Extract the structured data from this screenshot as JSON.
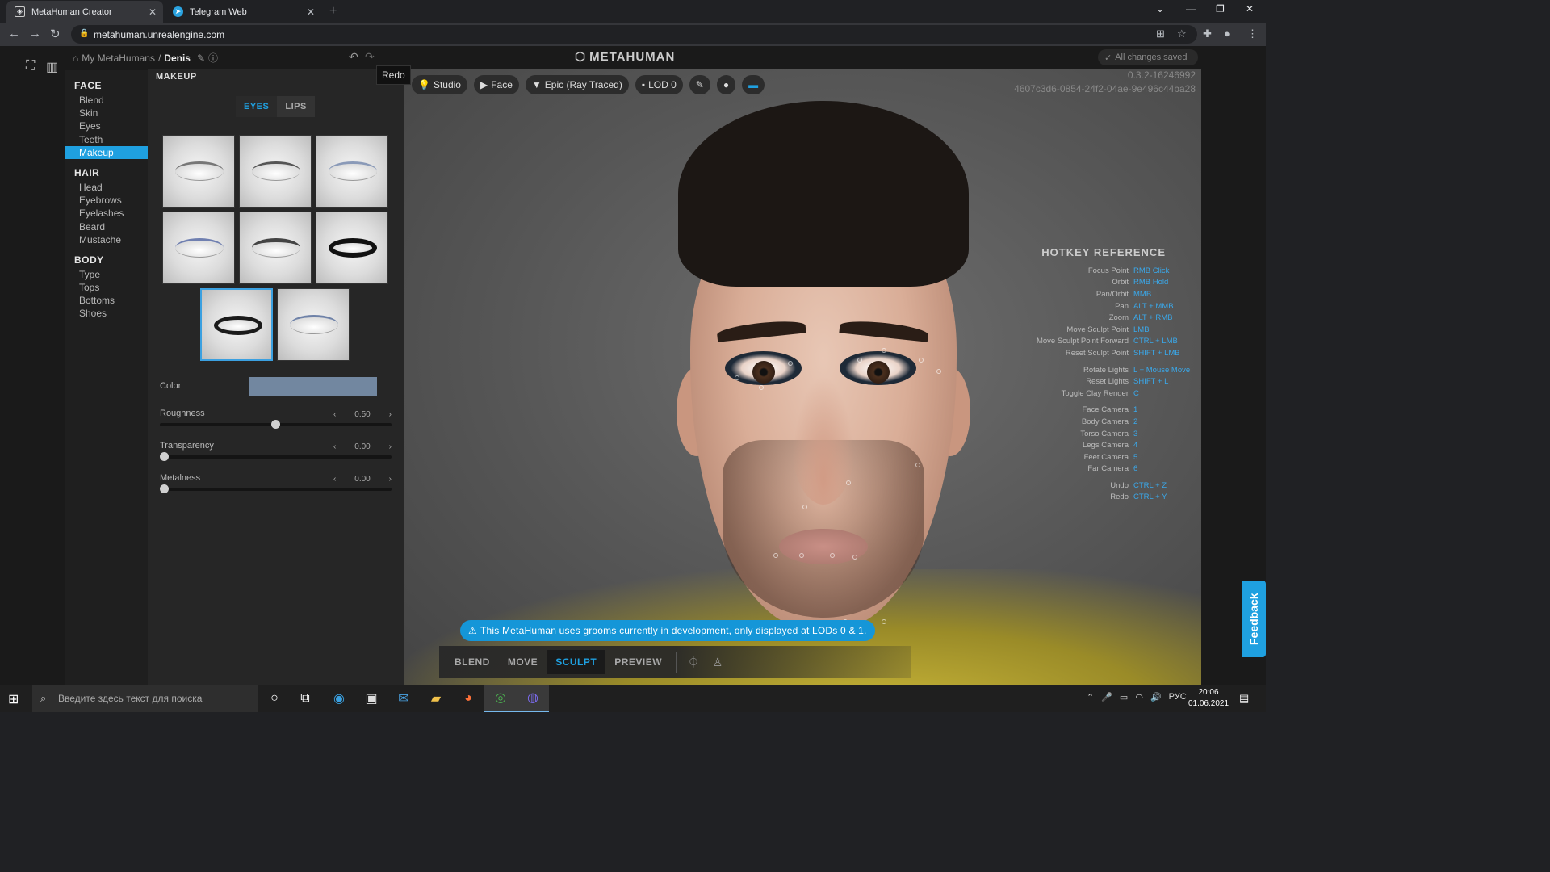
{
  "browser": {
    "tabs": [
      {
        "title": "MetaHuman Creator",
        "active": true
      },
      {
        "title": "Telegram Web",
        "active": false
      }
    ],
    "url": "metahuman.unrealengine.com"
  },
  "header": {
    "breadcrumb_root": "My MetaHumans",
    "breadcrumb_sep": "/",
    "breadcrumb_current": "Denis",
    "logo": "METAHUMAN",
    "saved_status": "All changes saved",
    "tooltip": "Redo"
  },
  "nav": {
    "sections": [
      {
        "title": "FACE",
        "items": [
          "Blend",
          "Skin",
          "Eyes",
          "Teeth",
          "Makeup"
        ]
      },
      {
        "title": "HAIR",
        "items": [
          "Head",
          "Eyebrows",
          "Eyelashes",
          "Beard",
          "Mustache"
        ]
      },
      {
        "title": "BODY",
        "items": [
          "Type",
          "Tops",
          "Bottoms",
          "Shoes"
        ]
      }
    ],
    "selected": "Makeup"
  },
  "panel": {
    "title": "MAKEUP",
    "tabs": [
      "EYES",
      "LIPS"
    ],
    "active_tab": "EYES",
    "presets_count": 8,
    "selected_preset": 7,
    "color_label": "Color",
    "color_value": "#7287a0",
    "sliders": [
      {
        "label": "Roughness",
        "value": "0.50",
        "fraction": 0.5
      },
      {
        "label": "Transparency",
        "value": "0.00",
        "fraction": 0.0
      },
      {
        "label": "Metalness",
        "value": "0.00",
        "fraction": 0.0
      }
    ]
  },
  "viewport": {
    "controls": [
      "Studio",
      "Face",
      "Epic (Ray Traced)",
      "LOD 0"
    ],
    "version": "0.3.2-16246992",
    "id": "4607c3d6-0854-24f2-04ae-9e496c44ba28",
    "hotkeys_title": "HOTKEY REFERENCE",
    "hotkey_groups": [
      [
        [
          "Focus Point",
          "RMB Click"
        ],
        [
          "Orbit",
          "RMB Hold"
        ],
        [
          "Pan/Orbit",
          "MMB"
        ],
        [
          "Pan",
          "ALT + MMB"
        ],
        [
          "Zoom",
          "ALT + RMB"
        ],
        [
          "Move Sculpt Point",
          "LMB"
        ],
        [
          "Move Sculpt Point Forward",
          "CTRL + LMB"
        ],
        [
          "Reset Sculpt Point",
          "SHIFT + LMB"
        ]
      ],
      [
        [
          "Rotate Lights",
          "L + Mouse Move"
        ],
        [
          "Reset Lights",
          "SHIFT + L"
        ],
        [
          "Toggle Clay Render",
          "C"
        ]
      ],
      [
        [
          "Face Camera",
          "1"
        ],
        [
          "Body Camera",
          "2"
        ],
        [
          "Torso Camera",
          "3"
        ],
        [
          "Legs Camera",
          "4"
        ],
        [
          "Feet Camera",
          "5"
        ],
        [
          "Far Camera",
          "6"
        ]
      ],
      [
        [
          "Undo",
          "CTRL + Z"
        ],
        [
          "Redo",
          "CTRL + Y"
        ]
      ]
    ],
    "warning": "This MetaHuman uses grooms currently in development, only displayed at LODs 0 & 1.",
    "modes": [
      "BLEND",
      "MOVE",
      "SCULPT",
      "PREVIEW"
    ],
    "active_mode": "SCULPT",
    "feedback": "Feedback"
  },
  "taskbar": {
    "search_placeholder": "Введите здесь текст для поиска",
    "lang": "РУС",
    "time": "20:06",
    "date": "01.06.2021"
  }
}
